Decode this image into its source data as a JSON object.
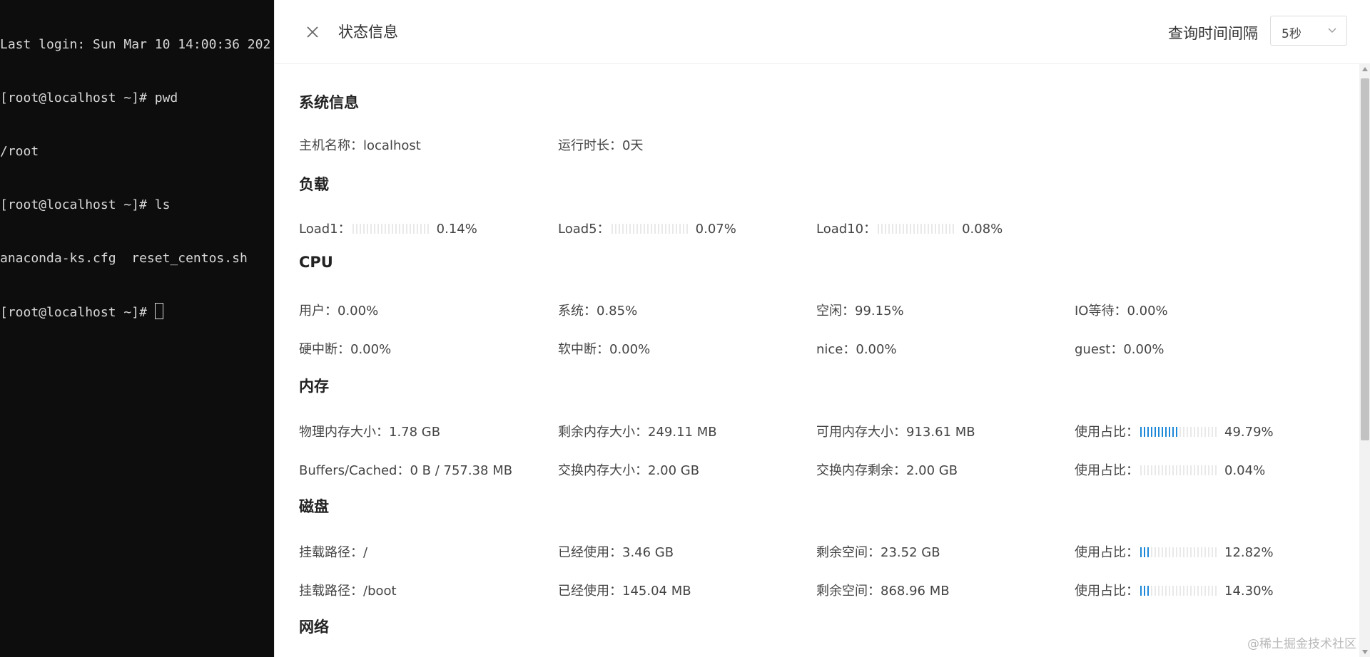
{
  "terminal": {
    "lines": [
      "Last login: Sun Mar 10 14:00:36 202",
      "[root@localhost ~]# pwd",
      "/root",
      "[root@localhost ~]# ls",
      "anaconda-ks.cfg  reset_centos.sh",
      "[root@localhost ~]# "
    ]
  },
  "header": {
    "title": "状态信息",
    "interval_label": "查询时间间隔",
    "interval_value": "5秒"
  },
  "system": {
    "title": "系统信息",
    "hostname": "主机名称：localhost",
    "uptime": "运行时长：0天"
  },
  "load": {
    "title": "负载",
    "items": [
      {
        "label": "Load1：",
        "value": "0.14%",
        "fraction": 0.0014
      },
      {
        "label": "Load5：",
        "value": "0.07%",
        "fraction": 0.0007
      },
      {
        "label": "Load10：",
        "value": "0.08%",
        "fraction": 0.0008
      }
    ]
  },
  "cpu": {
    "title": "CPU",
    "row1": [
      "用户：0.00%",
      "系统：0.85%",
      "空闲：99.15%",
      "IO等待：0.00%"
    ],
    "row2": [
      "硬中断：0.00%",
      "软中断：0.00%",
      "nice：0.00%",
      "guest：0.00%"
    ]
  },
  "memory": {
    "title": "内存",
    "row1": [
      "物理内存大小：1.78 GB",
      "剩余内存大小：249.11 MB",
      "可用内存大小：913.61 MB"
    ],
    "row1_usage": {
      "label": "使用占比：",
      "value": "49.79%",
      "fraction": 0.4979
    },
    "row2": [
      "Buffers/Cached：0 B / 757.38 MB",
      "交换内存大小：2.00 GB",
      "交换内存剩余：2.00 GB"
    ],
    "row2_usage": {
      "label": "使用占比：",
      "value": "0.04%",
      "fraction": 0.0004
    }
  },
  "disk": {
    "title": "磁盘",
    "row1": [
      "挂载路径：/",
      "已经使用：3.46 GB",
      "剩余空间：23.52 GB"
    ],
    "row1_usage": {
      "label": "使用占比：",
      "value": "12.82%",
      "fraction": 0.1282
    },
    "row2": [
      "挂载路径：/boot",
      "已经使用：145.04 MB",
      "剩余空间：868.96 MB"
    ],
    "row2_usage": {
      "label": "使用占比：",
      "value": "14.30%",
      "fraction": 0.143
    }
  },
  "network": {
    "title": "网络"
  },
  "watermark": "@稀土掘金技术社区",
  "colors": {
    "accent": "#1e88d8",
    "terminal_bg": "#0d0d0d"
  }
}
